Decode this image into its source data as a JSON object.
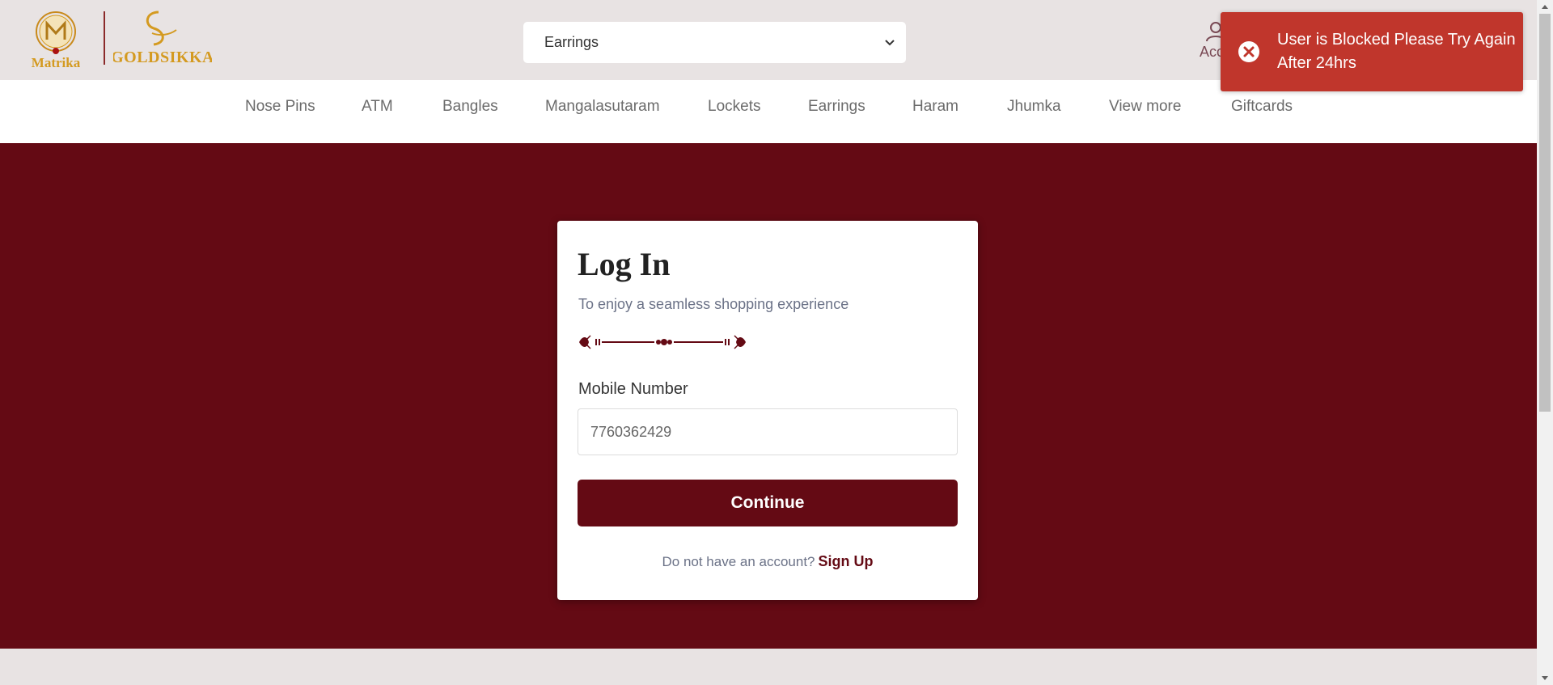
{
  "header": {
    "logo_left_text": "Matrika",
    "logo_right_text": "GOLDSIKKA",
    "category_select": {
      "selected": "Earrings"
    },
    "account_label": "Acco"
  },
  "toast": {
    "icon": "close-circle-icon",
    "message": "User is Blocked Please Try Again After 24hrs"
  },
  "nav": {
    "items": [
      "Nose Pins",
      "ATM",
      "Bangles",
      "Mangalasutaram",
      "Lockets",
      "Earrings",
      "Haram",
      "Jhumka",
      "View more",
      "Giftcards"
    ]
  },
  "login": {
    "title": "Log In",
    "subtitle": "To enjoy a seamless shopping experience",
    "mobile_label": "Mobile Number",
    "mobile_value": "7760362429",
    "continue_label": "Continue",
    "signup_prompt": "Do not have an account?",
    "signup_link": "Sign Up"
  },
  "colors": {
    "brand_maroon": "#640a14",
    "toast_red": "#c0362c",
    "gold": "#d49a20"
  }
}
